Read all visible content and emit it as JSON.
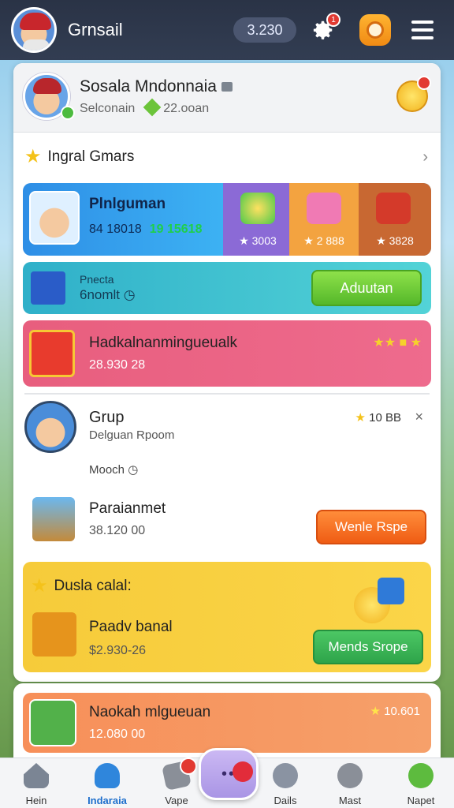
{
  "topbar": {
    "brand": "Grnsail",
    "coins": "3.230",
    "settings_badge": "1"
  },
  "profile": {
    "name": "Sosala Mndonnaia",
    "subtitle": "Selconain",
    "gems": "22.ooan"
  },
  "section": {
    "title": "Ingral Gmars"
  },
  "promo_row": {
    "title": "Plnlguman",
    "sub_left": "84 18018",
    "sub_right": "19 15618",
    "tiles": [
      {
        "value": "3003"
      },
      {
        "value": "2 888"
      },
      {
        "value": "3828"
      }
    ]
  },
  "adventure_row": {
    "line1": "Pnecta",
    "line2": "6nomlt",
    "button": "Aduutan"
  },
  "pink_row": {
    "title": "Hadkalnanmingueualk",
    "sub": "28.930 28"
  },
  "group": {
    "title": "Grup",
    "sub": "Delguan Rpoom",
    "meta": "10 BB",
    "mode": "Mooch"
  },
  "param": {
    "title": "Paraianmet",
    "sub": "38.120 00",
    "button": "Wenle Rspe"
  },
  "yellow_block": {
    "header": "Dusla calal:",
    "title": "Paadv banal",
    "sub": "$2.930-26",
    "button": "Mends Srope"
  },
  "bottom_row": {
    "title": "Naokah mlgueuan",
    "sub": "12.080 00",
    "meta": "10.601"
  },
  "nav": {
    "items": [
      {
        "label": "Hein"
      },
      {
        "label": "Indaraia"
      },
      {
        "label": "Vape"
      },
      {
        "label": "Dails"
      },
      {
        "label": "Mast"
      },
      {
        "label": "Napet"
      }
    ],
    "center_dots": "••"
  }
}
